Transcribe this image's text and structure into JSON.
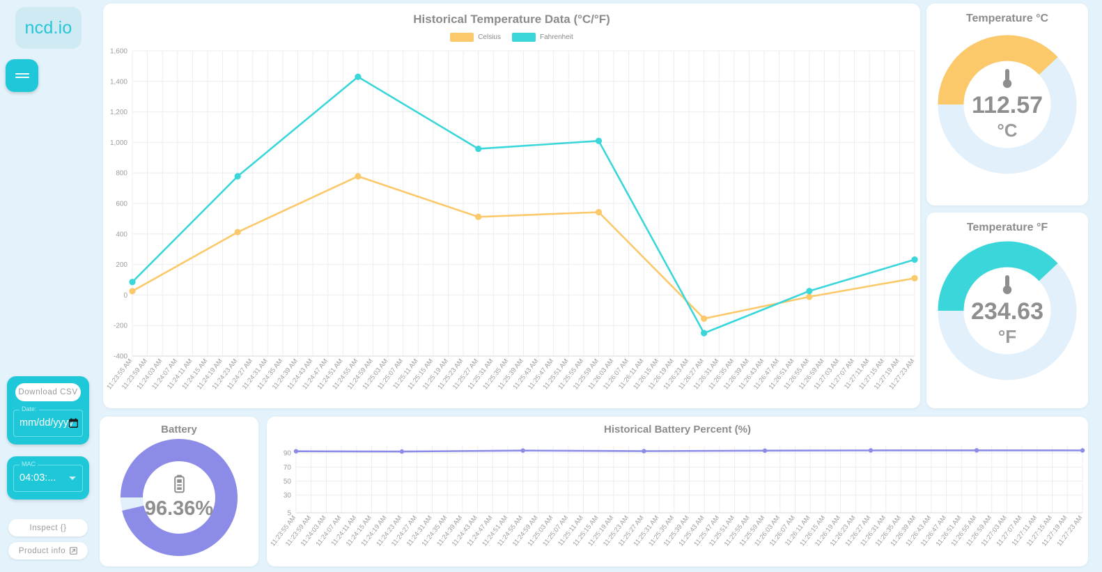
{
  "brand": {
    "logo_text": "ncd.io"
  },
  "sidebar": {
    "menu_icon": "hamburger-icon",
    "download_csv_label": "Download CSV",
    "date_field": {
      "label": "Date:",
      "value": "mm/dd/yyyy",
      "icon": "calendar-icon"
    },
    "mac_field": {
      "label": "MAC",
      "value": "04:03:...",
      "icon": "chevron-down-icon"
    },
    "inspect_label": "Inspect  {}",
    "product_info_label": "Product info",
    "product_info_icon": "external-link-icon"
  },
  "colors": {
    "celsius": "#fbc86a",
    "fahrenheit": "#3ad6da",
    "battery": "#8c8ce8",
    "track": "#e1f0fa",
    "page_bg": "#e3f2fb",
    "accent": "#1fc8d8"
  },
  "temperature_panel": {
    "title": "Historical Temperature Data (°C/°F)",
    "legend": [
      {
        "label": "Celsius",
        "color": "#fbc86a"
      },
      {
        "label": "Fahrenheit",
        "color": "#3ad6da"
      }
    ]
  },
  "gauges": [
    {
      "name": "temperature-celsius",
      "title": "Temperature °C",
      "value": "112.57",
      "unit": "°C",
      "percent": 38,
      "color": "#fbc86a",
      "icon": "thermometer-icon"
    },
    {
      "name": "temperature-fahrenheit",
      "title": "Temperature °F",
      "value": "234.63",
      "unit": "°F",
      "percent": 38,
      "color": "#3ad6da",
      "icon": "thermometer-icon"
    },
    {
      "name": "battery",
      "title": "Battery",
      "value": "96.36%",
      "unit": "",
      "percent": 96.36,
      "color": "#8c8ce8",
      "icon": "battery-icon"
    }
  ],
  "battery_panel": {
    "title": "Historical Battery Percent (%)"
  },
  "x_labels": [
    "11:23:55 AM",
    "11:23:59 AM",
    "11:24:03 AM",
    "11:24:07 AM",
    "11:24:11 AM",
    "11:24:15 AM",
    "11:24:19 AM",
    "11:24:23 AM",
    "11:24:27 AM",
    "11:24:31 AM",
    "11:24:35 AM",
    "11:24:39 AM",
    "11:24:43 AM",
    "11:24:47 AM",
    "11:24:51 AM",
    "11:24:55 AM",
    "11:24:59 AM",
    "11:25:03 AM",
    "11:25:07 AM",
    "11:25:11 AM",
    "11:25:15 AM",
    "11:25:19 AM",
    "11:25:23 AM",
    "11:25:27 AM",
    "11:25:31 AM",
    "11:25:35 AM",
    "11:25:39 AM",
    "11:25:43 AM",
    "11:25:47 AM",
    "11:25:51 AM",
    "11:25:55 AM",
    "11:25:59 AM",
    "11:26:03 AM",
    "11:26:07 AM",
    "11:26:11 AM",
    "11:26:15 AM",
    "11:26:19 AM",
    "11:26:23 AM",
    "11:26:27 AM",
    "11:26:31 AM",
    "11:26:35 AM",
    "11:26:39 AM",
    "11:26:43 AM",
    "11:26:47 AM",
    "11:26:51 AM",
    "11:26:55 AM",
    "11:26:59 AM",
    "11:27:03 AM",
    "11:27:07 AM",
    "11:27:11 AM",
    "11:27:15 AM",
    "11:27:19 AM",
    "11:27:23 AM"
  ],
  "chart_data": [
    {
      "type": "line",
      "name": "historical-temperature",
      "title": "Historical Temperature Data (°C/°F)",
      "xlabel": "",
      "ylabel": "",
      "ylim": [
        -400,
        1600
      ],
      "ytick_labels": [
        "1,600",
        "1,400",
        "1,200",
        "1,000",
        "800",
        "600",
        "400",
        "200",
        "0",
        "-200",
        "-400"
      ],
      "yticks": [
        1600,
        1400,
        1200,
        1000,
        800,
        600,
        400,
        200,
        0,
        -200,
        -400
      ],
      "grid": true,
      "legend_position": "top",
      "x": [
        "11:23:55 AM",
        "11:24:23 AM",
        "11:24:55 AM",
        "11:25:27 AM",
        "11:25:59 AM",
        "11:26:27 AM",
        "11:26:55 AM",
        "11:27:23 AM"
      ],
      "x_index": [
        0,
        7,
        15,
        23,
        31,
        38,
        45,
        52
      ],
      "series": [
        {
          "name": "Celsius",
          "color": "#fbc86a",
          "values": [
            25,
            412,
            778,
            512,
            543,
            -155,
            -12,
            110
          ]
        },
        {
          "name": "Fahrenheit",
          "color": "#3ad6da",
          "values": [
            85,
            778,
            1430,
            958,
            1010,
            -250,
            26,
            232
          ]
        }
      ]
    },
    {
      "type": "line",
      "name": "historical-battery-percent",
      "title": "Historical Battery Percent (%)",
      "xlabel": "",
      "ylabel": "",
      "ylim": [
        5,
        100
      ],
      "ytick_labels": [
        "90",
        "70",
        "50",
        "30",
        "5"
      ],
      "yticks": [
        90,
        70,
        50,
        30,
        5
      ],
      "grid": true,
      "legend_position": "none",
      "x": [
        "11:23:55 AM",
        "11:24:23 AM",
        "11:24:55 AM",
        "11:25:27 AM",
        "11:25:59 AM",
        "11:26:27 AM",
        "11:26:55 AM",
        "11:27:23 AM"
      ],
      "x_index": [
        0,
        7,
        15,
        23,
        31,
        38,
        45,
        52
      ],
      "series": [
        {
          "name": "Battery Percent",
          "color": "#8c8ce8",
          "values": [
            92.4,
            92.0,
            93.4,
            92.6,
            93.3,
            93.6,
            93.7,
            93.6
          ]
        }
      ]
    }
  ]
}
